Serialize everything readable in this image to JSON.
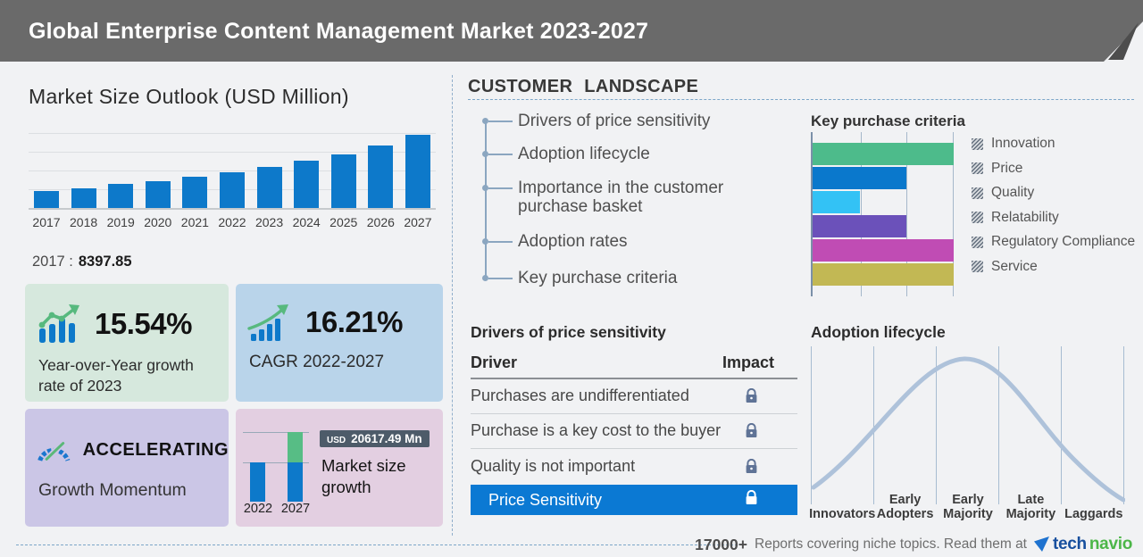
{
  "header": {
    "title": "Global Enterprise Content Management Market 2023-2027"
  },
  "market_outlook": {
    "title": "Market Size Outlook (USD Million)",
    "base_year_label": "2017 :",
    "base_year_value": "8397.85"
  },
  "chart_data": [
    {
      "id": "market_size_outlook",
      "type": "bar",
      "title": "Market Size Outlook (USD Million)",
      "categories": [
        "2017",
        "2018",
        "2019",
        "2020",
        "2021",
        "2022",
        "2023",
        "2024",
        "2025",
        "2026",
        "2027"
      ],
      "values": [
        8397.85,
        9700,
        11500,
        12950,
        14900,
        17200,
        19900,
        22900,
        26050,
        30300,
        35400
      ],
      "ylabel": "USD Million",
      "ylim": [
        0,
        36000
      ],
      "grid": true,
      "bar_color": "#0d79ca",
      "note": "2017 value labeled 8397.85; later values estimated from bar heights"
    },
    {
      "id": "key_purchase_criteria",
      "type": "bar-horizontal",
      "title": "Key purchase criteria",
      "categories": [
        "Innovation",
        "Price",
        "Quality",
        "Relatability",
        "Regulatory Compliance",
        "Service"
      ],
      "values": [
        3,
        2,
        1,
        2,
        3,
        3
      ],
      "xlim": [
        0,
        3
      ],
      "grid": true,
      "legend_position": "right",
      "colors": [
        "#4dbb8b",
        "#0a78cc",
        "#33c2f5",
        "#6b51ba",
        "#c04cb4",
        "#c2b854"
      ]
    },
    {
      "id": "market_size_growth",
      "type": "stacked-bar",
      "categories": [
        "2022",
        "2027"
      ],
      "growth_currency": "USD",
      "growth_value_mn": 20617.49,
      "note": "green segment on 2027 bar represents growth of USD 20617.49 Mn over 2022"
    },
    {
      "id": "adoption_lifecycle",
      "type": "curve",
      "curve": "bell",
      "categories": [
        "Innovators",
        "Early Adopters",
        "Early Majority",
        "Late Majority",
        "Laggards"
      ],
      "peak_stage": "Early Majority"
    }
  ],
  "stats": {
    "yoy": {
      "value": "15.54%",
      "label": "Year-over-Year growth rate of 2023"
    },
    "cagr": {
      "value": "16.21%",
      "label": "CAGR 2022-2027"
    },
    "momentum": {
      "value": "ACCELERATING",
      "label": "Growth Momentum"
    },
    "growth": {
      "currency": "USD",
      "amount": "20617.49 Mn",
      "label": "Market size growth",
      "year_start": "2022",
      "year_end": "2027"
    }
  },
  "customer_landscape": {
    "title": "CUSTOMER LANDSCAPE",
    "items": [
      "Drivers of price sensitivity",
      "Adoption lifecycle",
      "Importance in the customer purchase basket",
      "Adoption rates",
      "Key purchase criteria"
    ]
  },
  "kpc": {
    "title": "Key purchase criteria"
  },
  "drivers_table": {
    "title": "Drivers of price sensitivity",
    "col1": "Driver",
    "col2": "Impact",
    "rows": [
      "Purchases are undifferentiated",
      "Purchase is a key cost to the buyer",
      "Quality is not important"
    ],
    "highlight": "Price Sensitivity"
  },
  "adoption": {
    "title": "Adoption lifecycle"
  },
  "footer": {
    "count": "17000+",
    "text": "Reports covering niche topics. Read them at",
    "brand_tech": "tech",
    "brand_navio": "navio"
  },
  "colors": {
    "header_gray": "#6a6a6a",
    "accent_blue": "#0d79ca",
    "highlight_blue": "#0b79d3",
    "growth_green": "#57bd85",
    "card_green": "#d6e8dd",
    "card_blue": "#b9d4ea",
    "card_purple": "#cbc6e6",
    "card_pink": "#e3cfe1",
    "badge_slate": "#4d5b69",
    "curve_gray_blue": "#aec2da",
    "logo_blue": "#174f9e",
    "logo_green": "#4cb648"
  }
}
